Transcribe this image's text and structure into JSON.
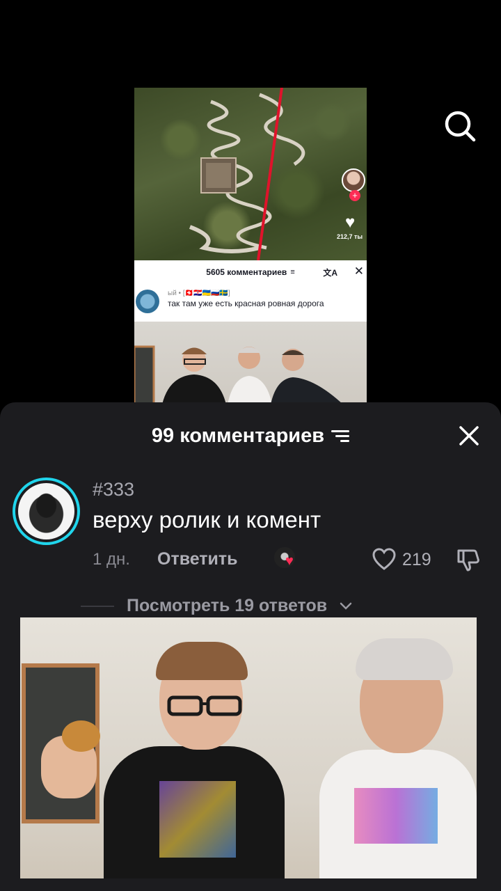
{
  "embedded_video": {
    "like_count": "212,7 ты",
    "comments_header": "5605 комментариев",
    "commenter": "ый • [🇨🇭🇭🇷🇺🇦🇷🇺🇸🇪]",
    "comment_text": "так там уже есть красная ровная дорога"
  },
  "sheet": {
    "title": "99 комментариев"
  },
  "comment": {
    "username": "#333",
    "text": "верху ролик и комент",
    "time": "1 дн.",
    "reply_label": "Ответить",
    "like_count": "219"
  },
  "replies": {
    "view_label": "Посмотреть 19 ответов"
  },
  "colors": {
    "accent": "#20d5ec",
    "like_pink": "#fe2c55",
    "sheet_bg": "#1c1c1f"
  },
  "icons": [
    "search-icon",
    "filter-icon",
    "close-icon",
    "heart-icon",
    "dislike-icon",
    "chevron-down-icon"
  ]
}
